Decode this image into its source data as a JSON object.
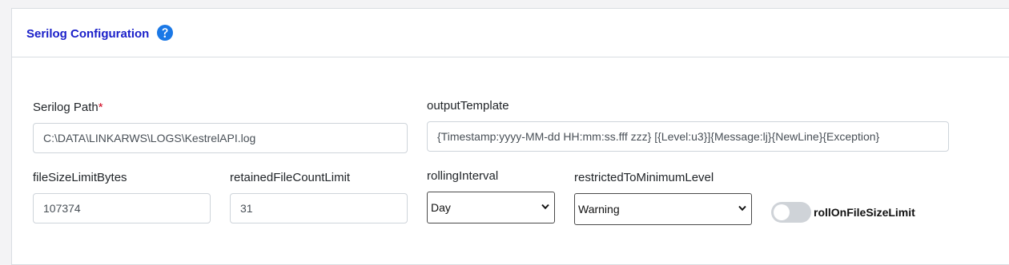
{
  "header": {
    "title": "Serilog Configuration",
    "help_icon": "question-circle-icon",
    "accent_color": "#1a78e6"
  },
  "fields": {
    "serilog_path": {
      "label": "Serilog Path",
      "required_mark": "*",
      "value": "C:\\DATA\\LINKARWS\\LOGS\\KestrelAPI.log"
    },
    "output_template": {
      "label": "outputTemplate",
      "value": "{Timestamp:yyyy-MM-dd HH:mm:ss.fff zzz} [{Level:u3}]{Message:lj}{NewLine}{Exception}"
    },
    "file_size_limit_bytes": {
      "label": "fileSizeLimitBytes",
      "value": "107374"
    },
    "retained_file_count_limit": {
      "label": "retainedFileCountLimit",
      "value": "31"
    },
    "rolling_interval": {
      "label": "rollingInterval",
      "selected": "Day"
    },
    "restricted_to_minimum_level": {
      "label": "restrictedToMinimumLevel",
      "selected": "Warning"
    },
    "roll_on_file_size_limit": {
      "label": "rollOnFileSizeLimit",
      "checked": false
    }
  }
}
